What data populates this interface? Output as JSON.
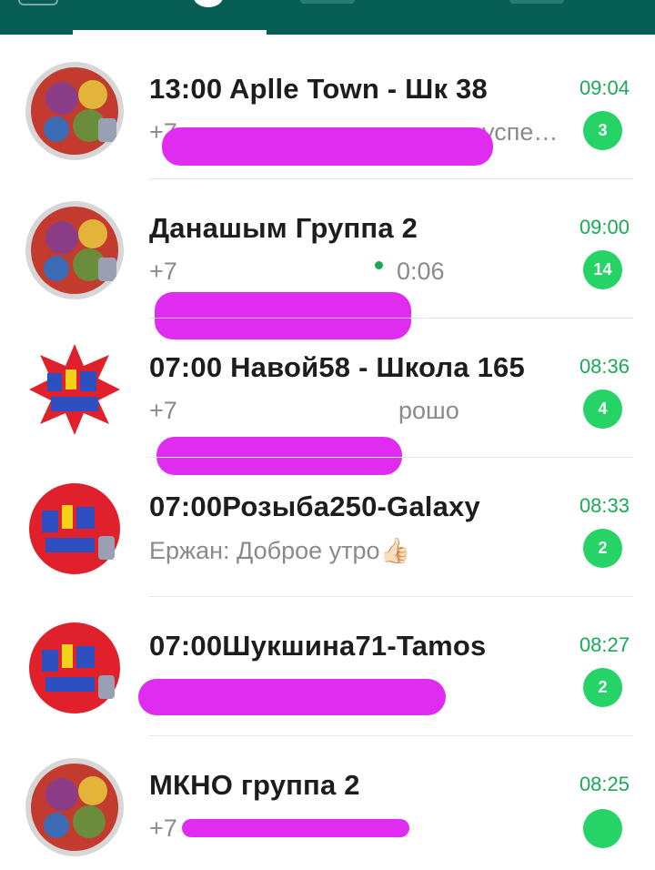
{
  "header": {
    "active_tab_indicator": true
  },
  "chats": [
    {
      "title": "13:00 Aplle Town - Шк 38",
      "time": "09:04",
      "preview_visible": "успе…",
      "unread": "3"
    },
    {
      "title": "Данашым Группа 2",
      "time": "09:00",
      "preview_visible": "0:06",
      "unread": "14"
    },
    {
      "title": "07:00 Навой58 - Школа 165",
      "time": "08:36",
      "preview_visible": "рошо",
      "unread": "4"
    },
    {
      "title": "07:00Розыба250-Galaxy",
      "time": "08:33",
      "preview_visible": "Ержан: Доброе утро👍🏻",
      "unread": "2"
    },
    {
      "title": "07:00Шукшина71-Tamos",
      "time": "08:27",
      "preview_visible": "",
      "unread": "2"
    },
    {
      "title": "МКНО группа 2",
      "time": "08:25",
      "preview_visible": "",
      "unread": ""
    }
  ],
  "colors": {
    "header": "#075e54",
    "accent_green": "#25d366",
    "time_green": "#1aaa55",
    "redaction": "#e02cf0"
  },
  "icons": {
    "avatar": "kids-taxi-logo",
    "mic": "microphone-icon"
  }
}
